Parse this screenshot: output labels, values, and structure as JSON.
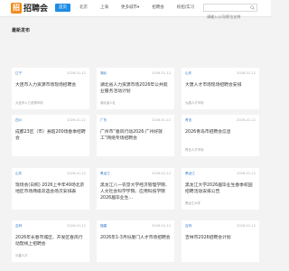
{
  "header": {
    "logo_mark": "招",
    "logo_text": "招聘会",
    "nav": [
      "首页",
      "北京",
      "上海",
      "更多城市▾",
      "招聘会",
      "校招/实习",
      "求职工具"
    ],
    "active_index": 0,
    "search_placeholder": "请输入公司/职位名称"
  },
  "section_title": "最新发布",
  "cards": [
    {
      "city": "辽宁",
      "date": "2026-01-12",
      "title": "大连市人力资源市场现场招聘会",
      "sub": "大连市人力资源市场"
    },
    {
      "city": "湖北",
      "date": "2026-01-12",
      "title": "湖北省人力资源市场2026年公共就业服务活动计划",
      "sub": "湖北省人社"
    },
    {
      "city": "山东",
      "date": "2026-01-12",
      "title": "大唐人才市场现场招聘会安排",
      "sub": "大唐人才市场"
    },
    {
      "city": "四川",
      "date": "2026-01-12",
      "title": "成都23区（市）县超200场春季招聘会",
      "sub": ""
    },
    {
      "city": "广东",
      "date": "2026-01-12",
      "title": "广州市“春风行动2026·广州好就工”网络专场招聘会",
      "sub": ""
    },
    {
      "city": "青岛",
      "date": "2026-01-12",
      "title": "2026青岛市招聘会信息",
      "sub": "青岛人才市场"
    },
    {
      "city": "山东",
      "date": "2026-01-12",
      "title": "现场会(日照) 2026上半年49场北京地区市场两级双选会场次安排表",
      "sub": ""
    },
    {
      "city": "黑龙江",
      "date": "2026-01-12",
      "title": "黑龙江八一农垦大学经济管理学院、人文社会科学学院、应用科技学院2026届毕业生...",
      "sub": ""
    },
    {
      "city": "黑龙江",
      "date": "2026-01-12",
      "title": "黑龙江大学2026届毕业生春季校园招聘活动安排公告",
      "sub": "黑龙江大学"
    },
    {
      "city": "吉林",
      "date": "2026-01-12",
      "title": "2026年长春市城区、开发区春风行动暨线上招聘会",
      "sub": "长春人才"
    },
    {
      "city": "福建",
      "date": "2026-01-12",
      "title": "2026年1-3月份厦门人才市场招聘会",
      "sub": ""
    },
    {
      "city": "吉林",
      "date": "2026-01-12",
      "title": "吉林市2026招聘会计划",
      "sub": ""
    }
  ]
}
